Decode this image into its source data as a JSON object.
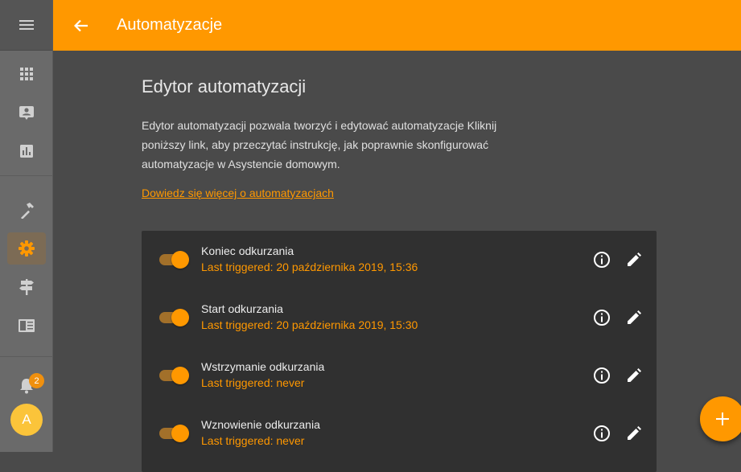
{
  "app": {
    "title": "Automatyzacje"
  },
  "sidebar": {
    "icons": [
      "menu-icon",
      "apps-grid-icon",
      "contact-card-icon",
      "chart-icon",
      "hammer-icon",
      "gear-icon",
      "signpost-icon",
      "book-icon",
      "bell-icon"
    ],
    "notifications_count": "2",
    "avatar_initial": "A"
  },
  "main": {
    "heading": "Edytor automatyzacji",
    "intro": "Edytor automatyzacji pozwala tworzyć i edytować automatyzacje Kliknij poniższy link, aby przeczytać instrukcję, jak poprawnie skonfigurować automatyzacje w Asystencie domowym.",
    "link": "Dowiedz się więcej o automatyzacjach"
  },
  "automations": [
    {
      "name": "Koniec odkurzania",
      "last_triggered": "Last triggered: 20 października 2019, 15:36",
      "enabled": true
    },
    {
      "name": "Start odkurzania",
      "last_triggered": "Last triggered: 20 października 2019, 15:30",
      "enabled": true
    },
    {
      "name": "Wstrzymanie odkurzania",
      "last_triggered": "Last triggered: never",
      "enabled": true
    },
    {
      "name": "Wznowienie odkurzania",
      "last_triggered": "Last triggered: never",
      "enabled": true
    }
  ],
  "colors": {
    "accent": "#ff9800",
    "sidebar": "#6a6a6a",
    "background": "#4a4a4a",
    "card": "#303030"
  }
}
